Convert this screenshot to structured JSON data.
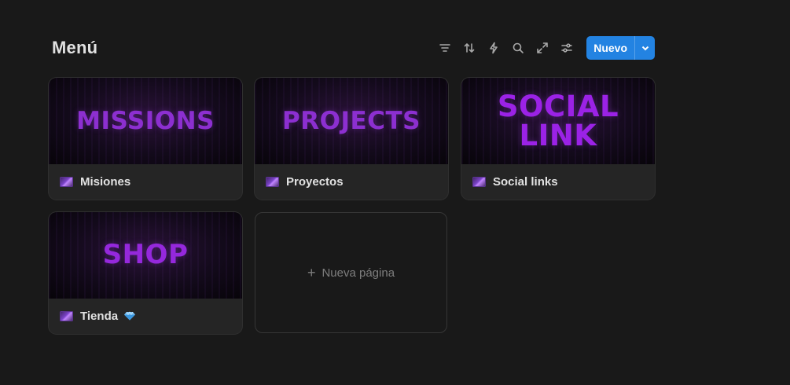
{
  "header": {
    "title": "Menú",
    "new_button_label": "Nuevo",
    "tools": [
      "filter-icon",
      "sort-icon",
      "automation-icon",
      "search-icon",
      "expand-icon",
      "settings-sliders-icon"
    ]
  },
  "cards": [
    {
      "cover_text": "MISSIONS",
      "title": "Misiones",
      "icon": "galaxy-page-icon"
    },
    {
      "cover_text": "PROJECTS",
      "title": "Proyectos",
      "icon": "galaxy-page-icon"
    },
    {
      "cover_text": "SOCIAL LINK",
      "title": "Social links",
      "icon": "galaxy-page-icon"
    },
    {
      "cover_text": "SHOP",
      "title": "Tienda",
      "icon": "galaxy-page-icon",
      "suffix_icon": "gem-icon"
    }
  ],
  "new_page": {
    "label": "Nueva página"
  },
  "colors": {
    "accent": "#2383e2",
    "background": "#191919",
    "cover_purple": "#8c2fd0"
  }
}
